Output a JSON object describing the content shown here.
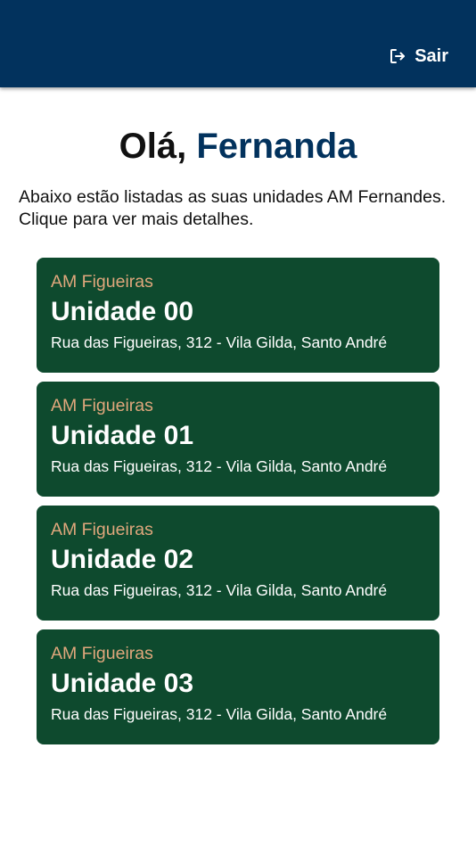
{
  "header": {
    "logout_label": "Sair",
    "logout_icon": "logout-icon",
    "background_color": "#02325d"
  },
  "greeting": {
    "prefix": "Olá,",
    "name": "Fernanda"
  },
  "intro_text": "Abaixo estão listadas as suas unidades AM Fernandes. Clique para ver mais detalhes.",
  "units": [
    {
      "brand": "AM Figueiras",
      "name": "Unidade 00",
      "address": "Rua das Figueiras, 312 - Vila Gilda, Santo André"
    },
    {
      "brand": "AM Figueiras",
      "name": "Unidade 01",
      "address": "Rua das Figueiras, 312 - Vila Gilda, Santo André"
    },
    {
      "brand": "AM Figueiras",
      "name": "Unidade 02",
      "address": "Rua das Figueiras, 312 - Vila Gilda, Santo André"
    },
    {
      "brand": "AM Figueiras",
      "name": "Unidade 03",
      "address": "Rua das Figueiras, 312 - Vila Gilda, Santo André"
    }
  ],
  "colors": {
    "primary": "#02325d",
    "card_background": "#0e4a2e",
    "card_brand_text": "#e0a77c"
  }
}
